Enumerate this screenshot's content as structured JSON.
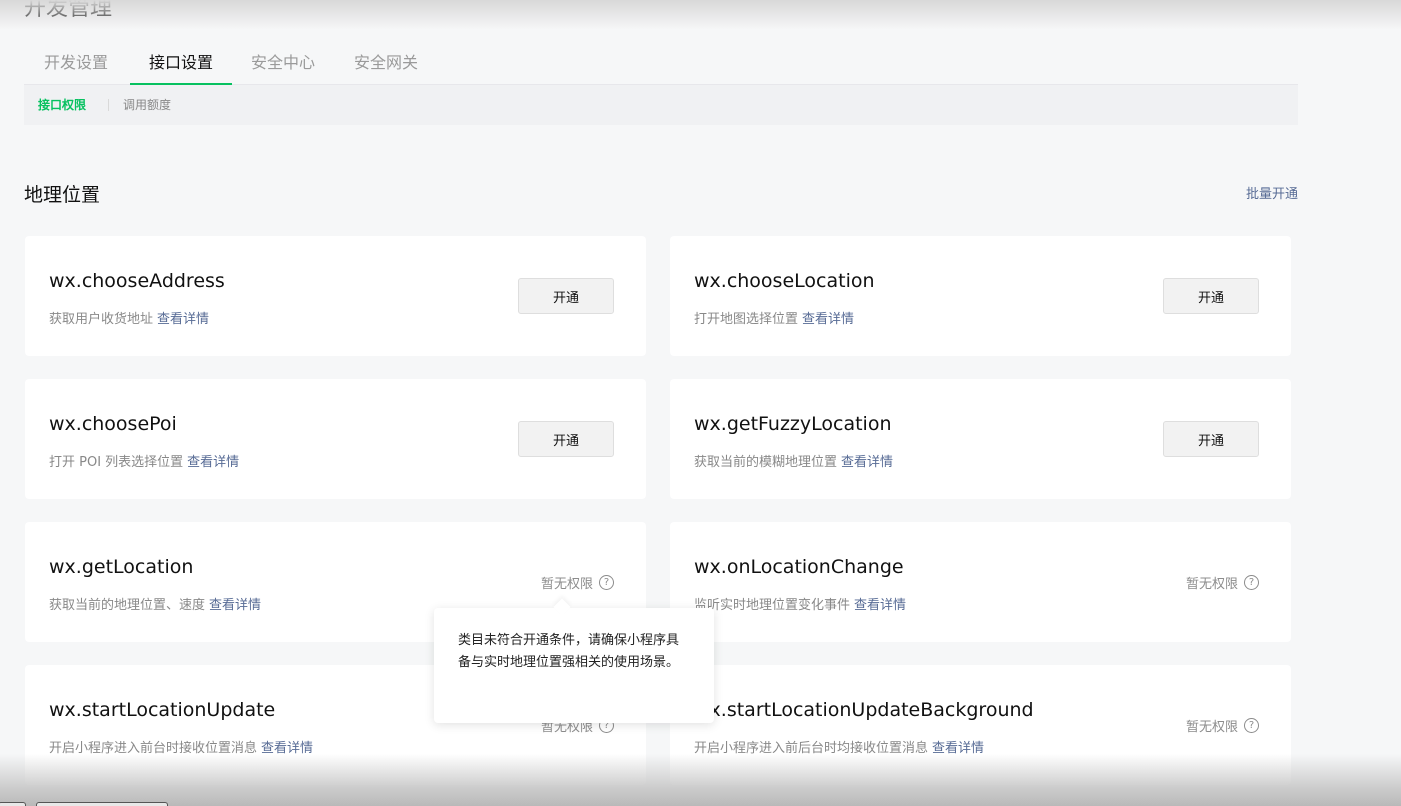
{
  "header": {
    "title": "开发管理"
  },
  "tabs": [
    {
      "label": "开发设置"
    },
    {
      "label": "接口设置"
    },
    {
      "label": "安全中心"
    },
    {
      "label": "安全网关"
    }
  ],
  "subnav": [
    {
      "label": "接口权限"
    },
    {
      "label": "调用额度"
    }
  ],
  "section": {
    "title": "地理位置",
    "batch_label": "批量开通"
  },
  "cards": [
    {
      "name": "wx.chooseAddress",
      "desc": "获取用户收货地址",
      "link": "查看详情",
      "action": "开通"
    },
    {
      "name": "wx.chooseLocation",
      "desc": "打开地图选择位置",
      "link": "查看详情",
      "action": "开通"
    },
    {
      "name": "wx.choosePoi",
      "desc": "打开 POI 列表选择位置",
      "link": "查看详情",
      "action": "开通"
    },
    {
      "name": "wx.getFuzzyLocation",
      "desc": "获取当前的模糊地理位置",
      "link": "查看详情",
      "action": "开通"
    },
    {
      "name": "wx.getLocation",
      "desc": "获取当前的地理位置、速度",
      "link": "查看详情",
      "status": "暂无权限"
    },
    {
      "name": "wx.onLocationChange",
      "desc": "监听实时地理位置变化事件",
      "link": "查看详情",
      "status": "暂无权限"
    },
    {
      "name": "wx.startLocationUpdate",
      "desc": "开启小程序进入前台时接收位置消息",
      "link": "查看详情",
      "status": "暂无权限"
    },
    {
      "name": "wx.startLocationUpdateBackground",
      "desc": "开启小程序进入前后台时均接收位置消息",
      "link": "查看详情",
      "status": "暂无权限"
    }
  ],
  "tooltip": {
    "text": "类目未符合开通条件，请确保小程序具备与实时地理位置强相关的使用场景。"
  },
  "colors": {
    "accent": "#07c160",
    "link": "#576b95"
  },
  "icons": {
    "help": "question-circle-icon"
  }
}
